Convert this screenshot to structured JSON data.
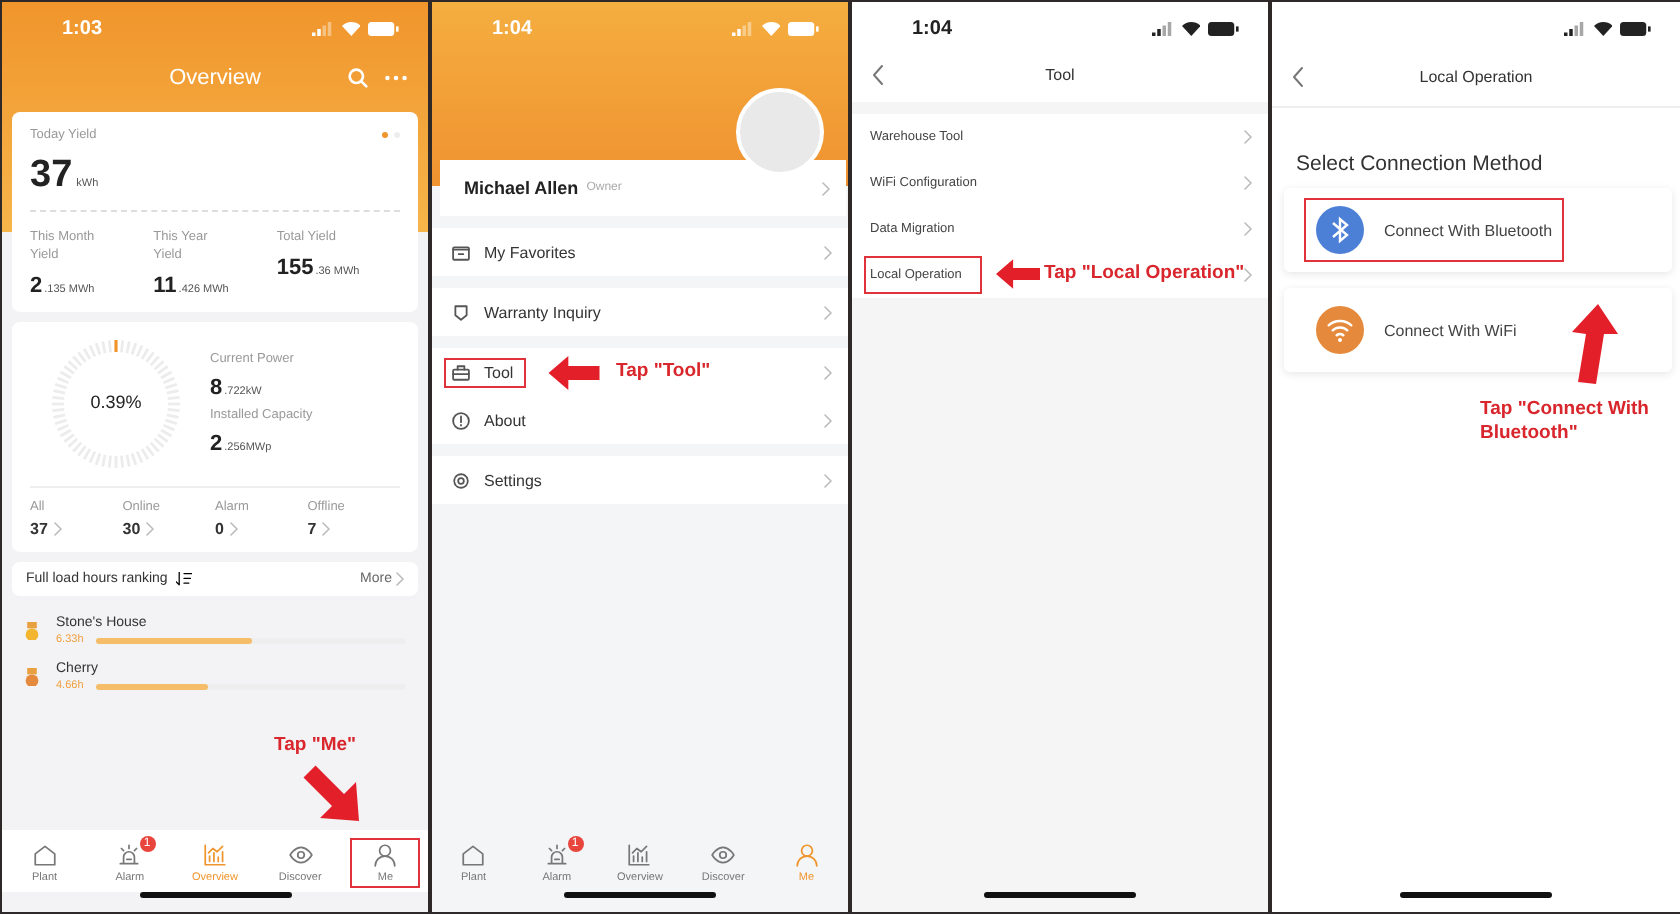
{
  "overview_screen": {
    "status_time": "1:03",
    "title": "Overview",
    "yield_card": {
      "pager": [
        {
          "selected": true
        },
        {
          "selected": false
        }
      ],
      "today_label": "Today Yield",
      "today_value": "37",
      "today_unit": "kWh",
      "stats": [
        {
          "label": "This Month Yield",
          "value": "2",
          "unit": ".135 MWh"
        },
        {
          "label": "This Year Yield",
          "value": "11",
          "unit": ".426 MWh"
        },
        {
          "label": "Total Yield",
          "value": "155",
          "unit": ".36 MWh"
        }
      ]
    },
    "power_card": {
      "gauge": {
        "reading": "0.39%"
      },
      "metrics": [
        {
          "label": "Current Power",
          "value": "8",
          "unit": ".722kW"
        },
        {
          "label": "Installed Capacity",
          "value": "2",
          "unit": ".256MWp"
        }
      ],
      "counts": [
        {
          "label": "All",
          "value": "37"
        },
        {
          "label": "Online",
          "value": "30"
        },
        {
          "label": "Alarm",
          "value": "0"
        },
        {
          "label": "Offline",
          "value": "7"
        }
      ]
    },
    "ranking": {
      "title": "Full load hours ranking",
      "more": "More",
      "items": [
        {
          "name": "Stone's House",
          "hours": "6.33h",
          "level": 0.5
        },
        {
          "name": "Cherry",
          "hours": "4.66h",
          "level": 0.36
        }
      ]
    },
    "tab_bar": [
      {
        "label": "Plant",
        "selected": false,
        "highlighted": false
      },
      {
        "label": "Alarm",
        "selected": false,
        "highlighted": false,
        "badge": "1"
      },
      {
        "label": "Overview",
        "selected": true,
        "highlighted": false
      },
      {
        "label": "Discover",
        "selected": false,
        "highlighted": false
      },
      {
        "label": "Me",
        "selected": false,
        "highlighted": true
      }
    ],
    "annotation": "Tap \"Me\""
  },
  "me_screen": {
    "status_time": "1:04",
    "user_name": "Michael Allen",
    "role": "Owner",
    "menu_groups": [
      [
        {
          "label": "My Favorites",
          "highlighted": false
        }
      ],
      [
        {
          "label": "Warranty Inquiry",
          "highlighted": false
        }
      ],
      [
        {
          "label": "Tool",
          "highlighted": true
        },
        {
          "label": "About",
          "highlighted": false
        }
      ],
      [
        {
          "label": "Settings",
          "highlighted": false
        }
      ]
    ],
    "tab_bar": [
      {
        "label": "Plant",
        "selected": false,
        "highlighted": false
      },
      {
        "label": "Alarm",
        "selected": false,
        "highlighted": false,
        "badge": "1"
      },
      {
        "label": "Overview",
        "selected": false,
        "highlighted": false
      },
      {
        "label": "Discover",
        "selected": false,
        "highlighted": false
      },
      {
        "label": "Me",
        "selected": true,
        "highlighted": false
      }
    ],
    "annotation": "Tap \"Tool\""
  },
  "tool_screen": {
    "status_time": "1:04",
    "title": "Tool",
    "items": [
      {
        "label": "Warehouse Tool",
        "highlighted": false
      },
      {
        "label": "WiFi Configuration",
        "highlighted": false
      },
      {
        "label": "Data Migration",
        "highlighted": false
      },
      {
        "label": "Local Operation",
        "highlighted": true
      }
    ],
    "annotation": "Tap \"Local Operation\""
  },
  "local_operation_screen": {
    "title": "Local Operation",
    "heading": "Select Connection Method",
    "options": [
      {
        "kind": "bluetooth",
        "label": "Connect With Bluetooth",
        "highlighted": true
      },
      {
        "kind": "wifi",
        "label": "Connect With WiFi",
        "highlighted": false
      }
    ],
    "annotation": "Tap \"Connect With Bluetooth\""
  }
}
